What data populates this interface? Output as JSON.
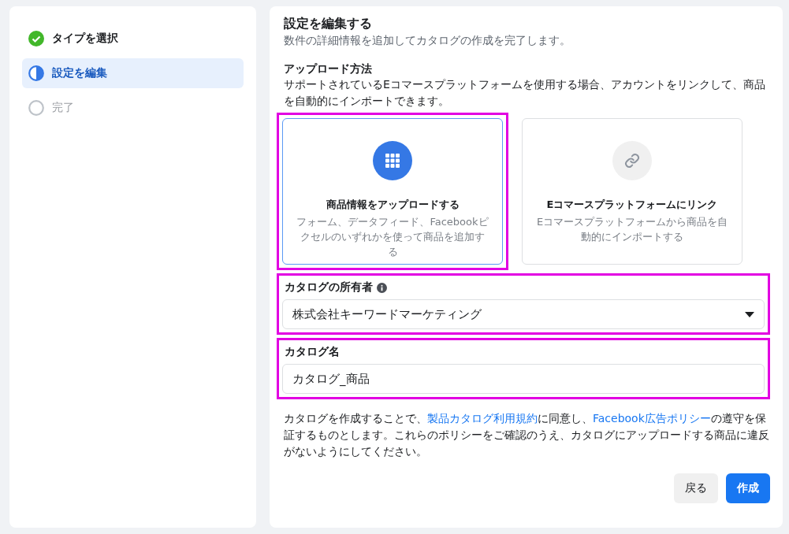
{
  "steps": [
    {
      "label": "タイプを選択",
      "kind": "done",
      "selected": false
    },
    {
      "label": "設定を編集",
      "kind": "current",
      "selected": true
    },
    {
      "label": "完了",
      "kind": "todo",
      "selected": false
    }
  ],
  "header": {
    "title": "設定を編集する",
    "subtitle": "数件の詳細情報を追加してカタログの作成を完了します。"
  },
  "upload": {
    "title": "アップロード方法",
    "description": "サポートされているEコマースプラットフォームを使用する場合、アカウントをリンクして、商品を自動的にインポートできます。",
    "options": [
      {
        "kind": "grid",
        "title": "商品情報をアップロードする",
        "description": "フォーム、データフィード、Facebookピクセルのいずれかを使って商品を追加する",
        "selected": true,
        "highlighted": true
      },
      {
        "kind": "link",
        "title": "Eコマースプラットフォームにリンク",
        "description": "Eコマースプラットフォームから商品を自動的にインポートする",
        "selected": false,
        "highlighted": false
      }
    ]
  },
  "owner": {
    "label": "カタログの所有者",
    "value": "株式会社キーワードマーケティング",
    "highlighted": true
  },
  "catalog_name": {
    "label": "カタログ名",
    "value": "カタログ_商品",
    "highlighted": true
  },
  "terms": [
    {
      "kind": "text",
      "text": "カタログを作成することで、"
    },
    {
      "kind": "link",
      "text": "製品カタログ利用規約"
    },
    {
      "kind": "text",
      "text": "に同意し、"
    },
    {
      "kind": "link",
      "text": "Facebook広告ポリシー"
    },
    {
      "kind": "text",
      "text": "の遵守を保証するものとします。これらのポリシーをご確認のうえ、カタログにアップロードする商品に違反がないようにしてください。"
    }
  ],
  "buttons": [
    {
      "label": "戻る",
      "kind": "secondary"
    },
    {
      "label": "作成",
      "kind": "primary"
    }
  ]
}
